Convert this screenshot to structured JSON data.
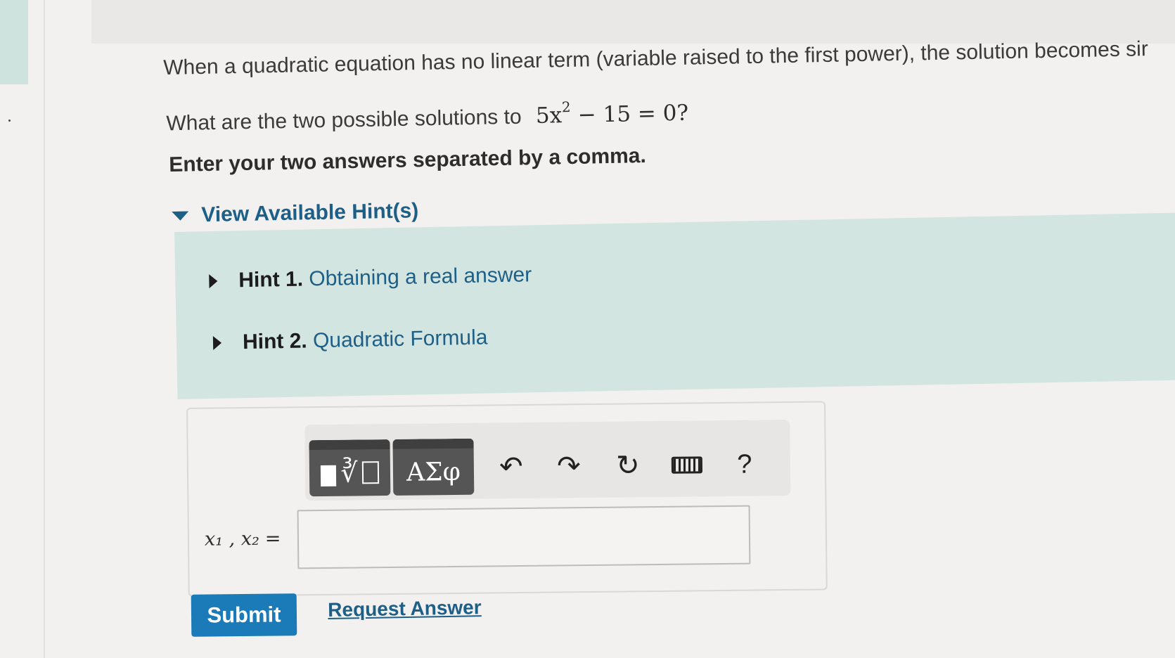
{
  "problem": {
    "intro_text": "When a quadratic equation has no linear term (variable raised to the first power), the solution becomes sir",
    "question_prefix": "What are the two possible solutions to",
    "equation_lhs": "5x",
    "equation_exponent": "2",
    "equation_rhs": " − 15 = 0",
    "question_suffix": "?",
    "instruction": "Enter your two answers separated by a comma."
  },
  "hints": {
    "toggle_label": "View Available Hint(s)",
    "items": [
      {
        "number": "Hint 1.",
        "title": "Obtaining a real answer"
      },
      {
        "number": "Hint 2.",
        "title": "Quadratic Formula"
      }
    ]
  },
  "toolbar": {
    "templates_icon": "templates-icon",
    "greek_label": "ΑΣφ",
    "undo_icon": "↶",
    "redo_icon": "↷",
    "reset_icon": "↻",
    "keyboard_icon": "keyboard-icon",
    "help_label": "?"
  },
  "answer": {
    "label_vars": "x₁ , x₂",
    "label_equals": "=",
    "value": ""
  },
  "actions": {
    "submit_label": "Submit",
    "request_label": "Request Answer"
  },
  "colors": {
    "accent_blue": "#1a7bb8",
    "link_blue": "#1d5f86",
    "hint_panel": "#d3e5e1"
  }
}
